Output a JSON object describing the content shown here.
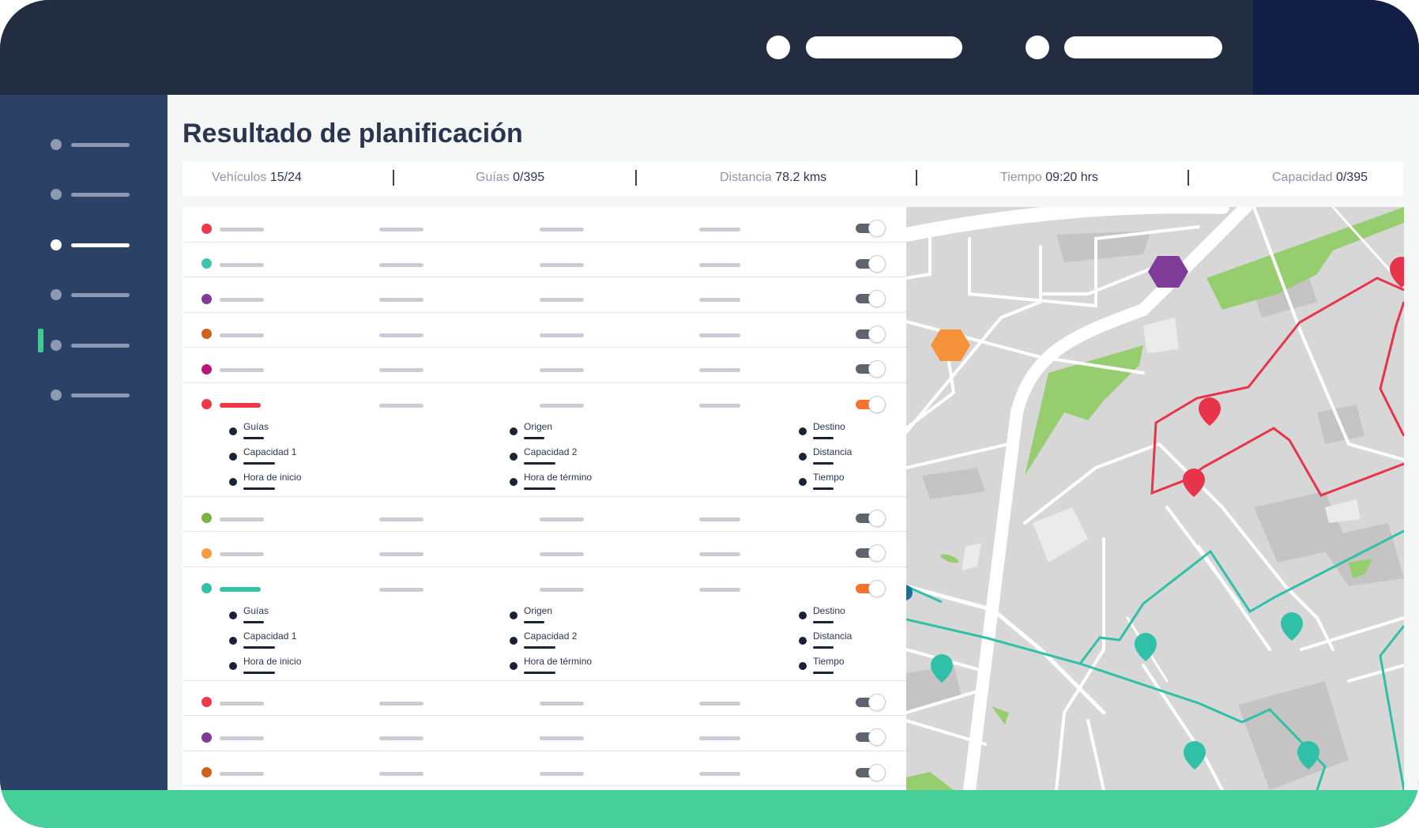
{
  "page": {
    "title": "Resultado de planificación"
  },
  "stats": [
    {
      "label": "Vehículos",
      "value": "15/24"
    },
    {
      "label": "Guías",
      "value": "0/395"
    },
    {
      "label": "Distancia",
      "value": "78.2 kms"
    },
    {
      "label": "Tiempo",
      "value": "09:20 hrs"
    },
    {
      "label": "Capacidad",
      "value": "0/395"
    }
  ],
  "sidebar": {
    "items": 6,
    "active_index": 2
  },
  "routes": [
    {
      "color": "#f0384b",
      "enabled": false,
      "expanded": false
    },
    {
      "color": "#3fc4ad",
      "enabled": false,
      "expanded": false
    },
    {
      "color": "#7e3c96",
      "enabled": false,
      "expanded": false
    },
    {
      "color": "#d2611f",
      "enabled": false,
      "expanded": false
    },
    {
      "color": "#b8177a",
      "enabled": false,
      "expanded": false
    },
    {
      "color": "#f0384b",
      "enabled": true,
      "expanded": true
    },
    {
      "color": "#7cb342",
      "enabled": false,
      "expanded": false
    },
    {
      "color": "#f99a3b",
      "enabled": false,
      "expanded": false
    },
    {
      "color": "#34c1a8",
      "enabled": true,
      "expanded": true
    },
    {
      "color": "#f0384b",
      "enabled": false,
      "expanded": false
    },
    {
      "color": "#7e3c96",
      "enabled": false,
      "expanded": false
    },
    {
      "color": "#d2611f",
      "enabled": false,
      "expanded": false
    }
  ],
  "route_details": {
    "col1": [
      "Guías",
      "Capacidad 1",
      "Hora de inicio"
    ],
    "col2": [
      "Origen",
      "Capacidad 2",
      "Hora de término"
    ],
    "col3": [
      "Destino",
      "Distancia",
      "Tiempo"
    ]
  },
  "map": {
    "route_red_color": "#e8344a",
    "route_teal_color": "#2fc0a7",
    "depot_purple": "#7e3c96",
    "depot_orange": "#f6923a",
    "park_color": "#96cd6e"
  }
}
